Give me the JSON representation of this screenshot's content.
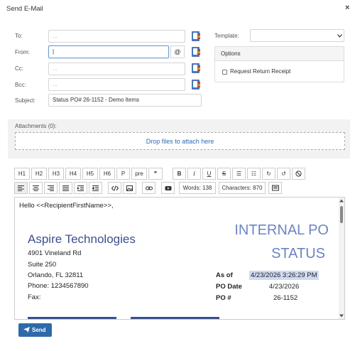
{
  "dialog": {
    "title": "Send E-Mail",
    "close_glyph": "×"
  },
  "form": {
    "to_label": "To:",
    "to_placeholder": "...",
    "from_label": "From:",
    "from_value": "|",
    "cc_label": "Cc:",
    "cc_placeholder": "...",
    "bcc_label": "Bcc:",
    "bcc_placeholder": "...",
    "subject_label": "Subject:",
    "subject_value": "Status PO# 26-1152 - Demo Items",
    "at_button": "@",
    "template_label": "Template:",
    "template_value": ""
  },
  "options": {
    "header": "Options",
    "request_receipt_label": "Request Return Receipt",
    "request_receipt_checked": false
  },
  "attachments": {
    "label": "Attachments (0):",
    "drop_text": "Drop files to attach here"
  },
  "toolbar": {
    "row1": [
      "H1",
      "H2",
      "H3",
      "H4",
      "H5",
      "H6",
      "P",
      "pre",
      "❞",
      "B",
      "I",
      "U",
      "S",
      "☰",
      "☷",
      "↻",
      "↺",
      "⃠"
    ],
    "words": "Words: 138",
    "characters": "Characters: 870"
  },
  "editor": {
    "greeting": "Hello <<RecipientFirstName>>,",
    "company": "Aspire Technologies",
    "address1": "4901 Vineland Rd",
    "address2": "Suite 250",
    "city": "Orlando, FL 32811",
    "phone": "Phone: 1234567890",
    "fax": "Fax:",
    "heading1": "INTERNAL PO",
    "heading2": "STATUS",
    "as_of_label": "As of",
    "as_of_value": "4/23/2026 3:26:29 PM",
    "po_date_label": "PO Date",
    "po_date_value": "4/23/2026",
    "po_num_label": "PO #",
    "po_num_value": "26-1152"
  },
  "send_button": "Send",
  "colors": {
    "accent": "#2f6aa8",
    "link": "#2a6bb7",
    "heading": "#6b84c4",
    "highlight": "#d0daf4"
  }
}
